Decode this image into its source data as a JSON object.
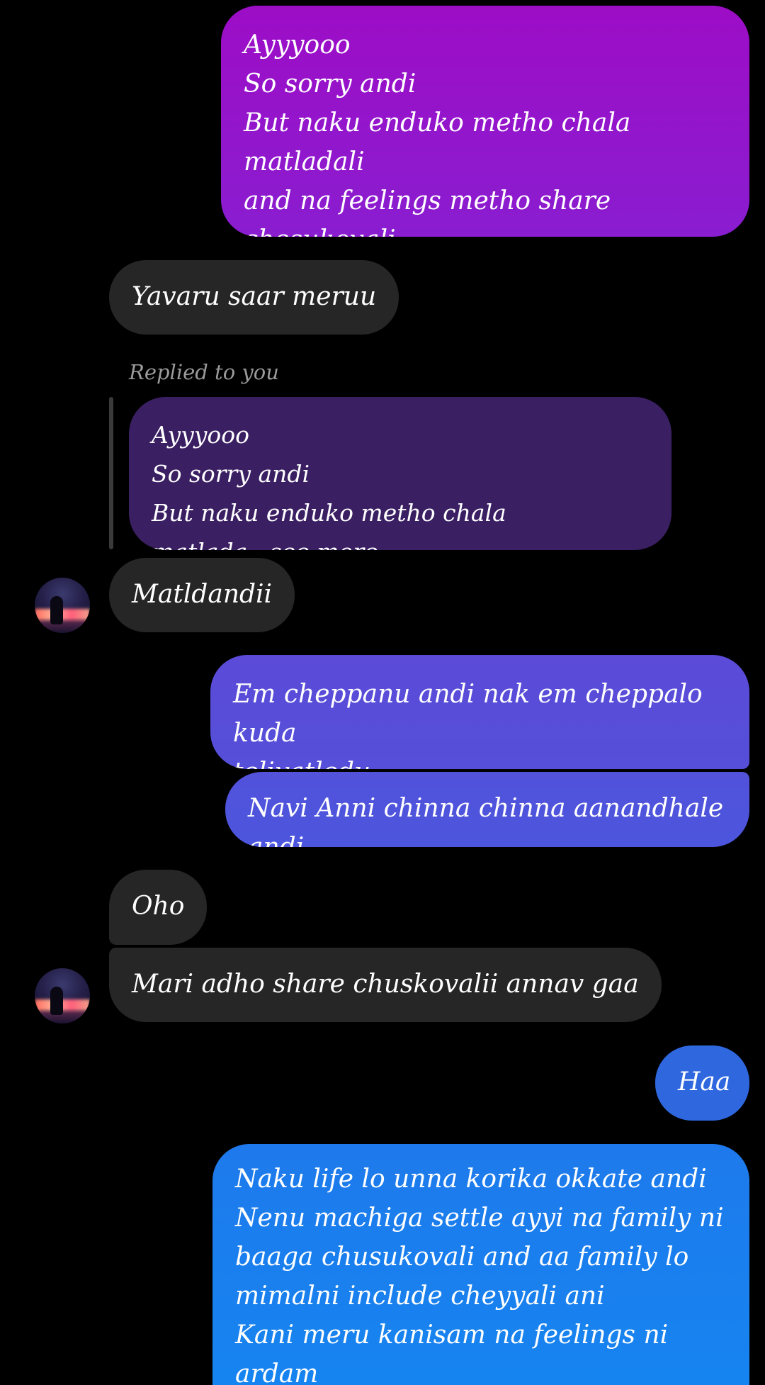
{
  "colors": {
    "background": "#000000",
    "received_bubble": "#262626",
    "reply_preview_bubble": "#3a1f62",
    "sent_gradient_top": "#9b0fc8",
    "sent_gradient_bottom": "#1d7ff0"
  },
  "messages": [
    {
      "id": "m1",
      "direction": "sent",
      "text": "Ayyyooo\nSo sorry andi\nBut naku enduko metho chala matladali\nand na feelings metho share chesukovali\nani anipistundhi andi anduke stories petta"
    },
    {
      "id": "m2",
      "direction": "received",
      "text": "Yavaru saar meruu"
    },
    {
      "id": "m3",
      "direction": "received",
      "reply_label": "Replied to you",
      "reply_preview": "Ayyyooo\nSo sorry andi\nBut naku enduko metho chala matlada...see more",
      "text": "Matldandii",
      "avatar_icon": "avatar-icon"
    },
    {
      "id": "m4",
      "direction": "sent",
      "text": "Em cheppanu andi nak em cheppalo kuda\nteliyatledu"
    },
    {
      "id": "m5",
      "direction": "sent",
      "text": "Navi Anni chinna chinna aanandhale andi"
    },
    {
      "id": "m6",
      "direction": "received",
      "text": "Oho"
    },
    {
      "id": "m7",
      "direction": "received",
      "text": "Mari adho share chuskovalii annav gaa",
      "avatar_icon": "avatar-icon"
    },
    {
      "id": "m8",
      "direction": "sent",
      "text": "Haa"
    },
    {
      "id": "m9",
      "direction": "sent",
      "text": "Naku life lo unna korika okkate andi\nNenu machiga settle ayyi na family ni\nbaaga chusukovali and aa family lo\nmimalni include cheyyali ani\nKani meru kanisam na feelings ni ardam"
    }
  ]
}
